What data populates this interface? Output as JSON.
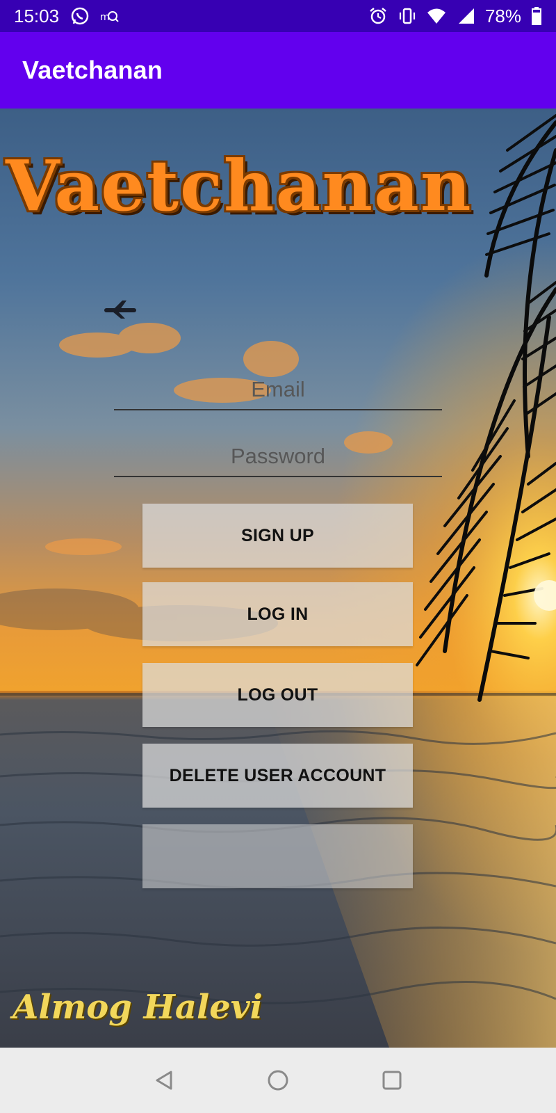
{
  "status_bar": {
    "time": "15:03",
    "battery": "78%"
  },
  "app_bar": {
    "title": "Vaetchanan"
  },
  "background": {
    "logo_text": "Vaetchanan",
    "signature": "Almog Halevi"
  },
  "form": {
    "email_placeholder": "Email",
    "email_value": "",
    "password_placeholder": "Password",
    "password_value": ""
  },
  "buttons": {
    "signup": "SIGN UP",
    "login": "LOG IN",
    "logout": "LOG OUT",
    "delete": "DELETE USER ACCOUNT",
    "empty": ""
  },
  "colors": {
    "status_bar": "#3700b3",
    "app_bar": "#6200ee",
    "button_bg": "#dcdcdc",
    "logo_orange": "#ff8a1f"
  },
  "icons": [
    "whatsapp-icon",
    "notification-icon",
    "alarm-icon",
    "vibrate-icon",
    "wifi-icon",
    "signal-icon",
    "battery-icon",
    "back-icon",
    "home-icon",
    "recents-icon"
  ]
}
